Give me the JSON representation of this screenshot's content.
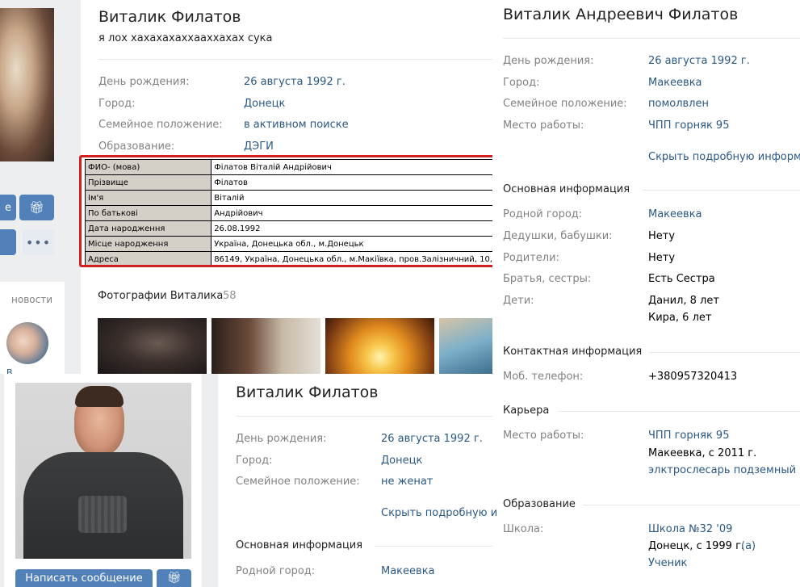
{
  "left_strip": {
    "news_label": "новости",
    "cut_name": "В"
  },
  "profile_top": {
    "name": "Виталик Филатов",
    "status": "я лох хахахахаххааххахах сука",
    "rows": [
      {
        "label": "День рождения:",
        "value": "26 августа 1992 г."
      },
      {
        "label": "Город:",
        "value": "Донецк"
      },
      {
        "label": "Семейное положение:",
        "value": "в активном поиске"
      },
      {
        "label": "Образование:",
        "value": "ДЭГИ"
      }
    ],
    "button_partial": "е",
    "photos_title": "Фотографии Виталика",
    "photos_count": "58"
  },
  "ukr_table": {
    "rows": [
      {
        "k": "ФИО- (мова)",
        "v": "Філатов Віталій Андрійович"
      },
      {
        "k": "Прізвище",
        "v": "Філатов"
      },
      {
        "k": "Ім'я",
        "v": "Віталій"
      },
      {
        "k": "По батькові",
        "v": "Андрійович"
      },
      {
        "k": "Дата народження",
        "v": "26.08.1992"
      },
      {
        "k": "Місце народження",
        "v": "Україна, Донецька обл., м.Донецьк"
      },
      {
        "k": "Адреса",
        "v": "86149, Україна, Донецька обл., м.Макіївка, пров.Залізничний, 10,"
      }
    ]
  },
  "profile_right": {
    "name": "Виталик Андреевич Филатов",
    "rows": [
      {
        "label": "День рождения:",
        "value": "26 августа 1992 г."
      },
      {
        "label": "Город:",
        "value": "Макеевка"
      },
      {
        "label": "Семейное положение:",
        "value": "помолвлен"
      },
      {
        "label": "Место работы:",
        "value": "ЧПП горняк 95"
      }
    ],
    "hide_link": "Скрыть подробную информа",
    "main_info_title": "Основная информация",
    "main_rows": [
      {
        "label": "Родной город:",
        "value": "Макеевка"
      },
      {
        "label": "Дедушки, бабушки:",
        "value": "Нету"
      },
      {
        "label": "Родители:",
        "value": "Нету"
      },
      {
        "label": "Братья, сестры:",
        "value": "Есть Сестра"
      },
      {
        "label": "Дети:",
        "value": "Данил, 8 лет"
      }
    ],
    "children_second": "Кира, 6 лет",
    "contact_title": "Контактная информация",
    "phone_label": "Моб. телефон:",
    "phone_value": "+380957320413",
    "career_title": "Карьера",
    "career_label": "Место работы:",
    "career_company": "ЧПП горняк 95",
    "career_city": "Макеевка, с 2011 г.",
    "career_position": "элктрослесарь подземный",
    "edu_title": "Образование",
    "school_label": "Школа:",
    "school_value": "Школа №32 '09",
    "school_city": "Донецк, с 1999 г.",
    "school_class": "(а)",
    "school_role": "Ученик"
  },
  "profile_bottom": {
    "name": "Виталик Филатов",
    "rows": [
      {
        "label": "День рождения:",
        "value": "26 августа 1992 г."
      },
      {
        "label": "Город:",
        "value": "Донецк"
      },
      {
        "label": "Семейное положение:",
        "value": "не женат"
      }
    ],
    "hide_link": "Скрыть подробную и",
    "main_info_title": "Основная информация",
    "hometown_label": "Родной город:",
    "hometown_value": "Макеевка",
    "message_button": "Написать сообщение"
  },
  "colors": {
    "link": "#2a5885",
    "label": "#828282",
    "button": "#5181b8",
    "highlight": "#d21f1f"
  },
  "icons": [
    "gift-icon",
    "more-icon"
  ]
}
